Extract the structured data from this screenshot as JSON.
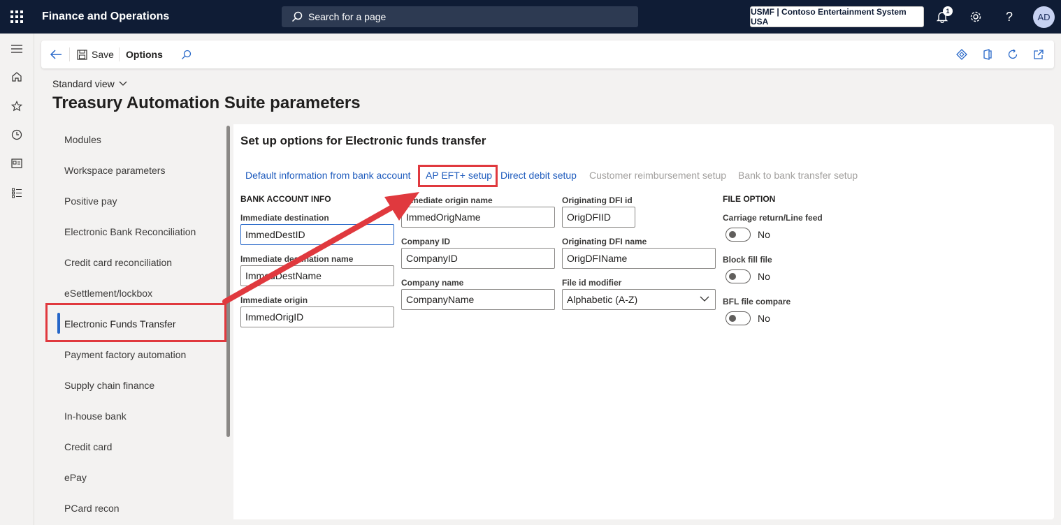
{
  "header": {
    "app_title": "Finance and Operations",
    "search_placeholder": "Search for a page",
    "company": "USMF | Contoso Entertainment System USA",
    "notification_count": "1",
    "help_label": "?",
    "avatar_initials": "AD"
  },
  "actions": {
    "save_label": "Save",
    "options_label": "Options"
  },
  "view": {
    "label": "Standard view"
  },
  "page": {
    "title": "Treasury Automation Suite parameters"
  },
  "nav": {
    "items": [
      "Modules",
      "Workspace parameters",
      "Positive pay",
      "Electronic Bank Reconciliation",
      "Credit card reconciliation",
      "eSettlement/lockbox",
      "Electronic Funds Transfer",
      "Payment factory automation",
      "Supply chain finance",
      "In-house bank",
      "Credit card",
      "ePay",
      "PCard recon"
    ],
    "selected_index": 6
  },
  "content": {
    "title": "Set up options for Electronic funds transfer",
    "tabs": [
      {
        "label": "Default information from bank account",
        "state": "link"
      },
      {
        "label": "AP EFT+ setup",
        "state": "link"
      },
      {
        "label": "Direct debit setup",
        "state": "link"
      },
      {
        "label": "Customer reimbursement setup",
        "state": "disabled"
      },
      {
        "label": "Bank to bank transfer setup",
        "state": "disabled"
      }
    ]
  },
  "bank_account_info": {
    "heading": "BANK ACCOUNT INFO",
    "immediate_destination_label": "Immediate destination",
    "immediate_destination_value": "ImmedDestID",
    "immediate_destination_name_label": "Immediate destination name",
    "immediate_destination_name_value": "ImmedDestName",
    "immediate_origin_label": "Immediate origin",
    "immediate_origin_value": "ImmedOrigID",
    "immediate_origin_name_label": "Immediate origin name",
    "immediate_origin_name_value": "ImmedOrigName",
    "company_id_label": "Company ID",
    "company_id_value": "CompanyID",
    "company_name_label": "Company name",
    "company_name_value": "CompanyName",
    "originating_dfi_id_label": "Originating DFI id",
    "originating_dfi_id_value": "OrigDFIID",
    "originating_dfi_name_label": "Originating DFI name",
    "originating_dfi_name_value": "OrigDFIName",
    "file_id_modifier_label": "File id modifier",
    "file_id_modifier_value": "Alphabetic (A-Z)"
  },
  "file_option": {
    "heading": "FILE OPTION",
    "carriage_label": "Carriage return/Line feed",
    "carriage_value": "No",
    "block_fill_label": "Block fill file",
    "block_fill_value": "No",
    "bfl_compare_label": "BFL file compare",
    "bfl_compare_value": "No"
  },
  "colors": {
    "topbar": "#0f1c35",
    "link": "#1e5bbd",
    "highlight": "#e0393e",
    "selected_marker": "#2566c8"
  }
}
